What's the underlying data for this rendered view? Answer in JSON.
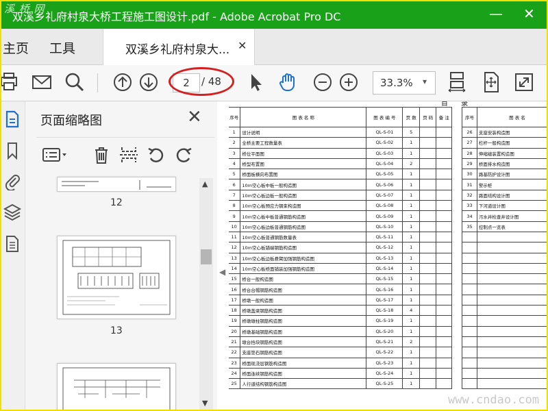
{
  "window": {
    "title": "双溪乡礼府村泉大桥工程施工图设计.pdf - Adobe Acrobat Pro DC",
    "watermark_top": "溪 桥 网",
    "minimize_glyph": "—",
    "close_glyph": "✕"
  },
  "tabs": {
    "home": "主页",
    "tools": "工具",
    "document": "双溪乡礼府村泉大...",
    "document_close": "✕"
  },
  "toolbar": {
    "page_current": "2",
    "page_total": "/ 48",
    "zoom": "33.3%",
    "zoom_arrow": "▾",
    "annotation_color": "#d32020"
  },
  "panel": {
    "title": "页面缩略图",
    "close": "✕",
    "thumbnails": [
      {
        "page": "12"
      },
      {
        "page": "13"
      }
    ],
    "scroll_up": "▲",
    "scroll_down": "▼"
  },
  "document": {
    "heading": "目 录",
    "left_table": {
      "headers": [
        "序号",
        "图 表 名 称",
        "图 表 编 号",
        "页 数",
        "页 码",
        "备 注"
      ],
      "rows": [
        [
          "1",
          "设计说明",
          "QL-S-01",
          "5"
        ],
        [
          "2",
          "全桥主要工程数量表",
          "QL-S-02",
          "1"
        ],
        [
          "3",
          "桥位平面图",
          "QL-S-03",
          "1"
        ],
        [
          "4",
          "桥型布置图",
          "QL-S-04",
          "2"
        ],
        [
          "5",
          "桥面板横向布置图",
          "QL-S-05",
          "1"
        ],
        [
          "6",
          "10m空心板中板一般构造图",
          "QL-S-06",
          "1"
        ],
        [
          "7",
          "10m空心板边板一般构造图",
          "QL-S-07",
          "1"
        ],
        [
          "8",
          "10m空心板预应力钢束构造图",
          "QL-S-08",
          "1"
        ],
        [
          "9",
          "10m空心板中板普通钢筋构造图",
          "QL-S-09",
          "1"
        ],
        [
          "10",
          "10m空心板边板普通钢筋构造图",
          "QL-S-10",
          "1"
        ],
        [
          "11",
          "10m空心板普通钢筋数量表",
          "QL-S-11",
          "1"
        ],
        [
          "12",
          "10m空心板锚端钢筋构造图",
          "QL-S-12",
          "1"
        ],
        [
          "13",
          "10m空心板边板悬臂加强钢筋构造图",
          "QL-S-13",
          "1"
        ],
        [
          "14",
          "10m空心板桥面铺装加强钢筋构造图",
          "QL-S-14",
          "1"
        ],
        [
          "15",
          "桥台一般构造图",
          "QL-S-15",
          "1"
        ],
        [
          "16",
          "桥台台帽钢筋构造图",
          "QL-S-16",
          "1"
        ],
        [
          "17",
          "桥墩一般构造图",
          "QL-S-17",
          "1"
        ],
        [
          "18",
          "桥墩盖梁钢筋构造图",
          "QL-S-18",
          "4"
        ],
        [
          "19",
          "桥墩墩柱钢筋构造图",
          "QL-S-19",
          "1"
        ],
        [
          "20",
          "桥墩基础钢筋构造图",
          "QL-S-20",
          "1"
        ],
        [
          "21",
          "墩台挡块钢筋构造图",
          "QL-S-21",
          "2"
        ],
        [
          "22",
          "支座垫石钢筋构造图",
          "QL-S-22",
          "1"
        ],
        [
          "23",
          "桥面现浇层钢筋构造图",
          "QL-S-23",
          "1"
        ],
        [
          "24",
          "桥面连续钢筋构造图",
          "QL-S-24",
          "1"
        ],
        [
          "25",
          "人行道结构钢筋构造图",
          "QL-S-25",
          "1"
        ]
      ]
    },
    "right_table": {
      "headers": [
        "序号",
        "图 表 名"
      ],
      "rows": [
        [
          "26",
          "支座安装构造图"
        ],
        [
          "27",
          "栏杆一般构造图"
        ],
        [
          "28",
          "伸缩缝装置构造图"
        ],
        [
          "29",
          "桥面排水构造图"
        ],
        [
          "30",
          "路基防护设计图"
        ],
        [
          "31",
          "警示桩"
        ],
        [
          "32",
          "路面结构设计图"
        ],
        [
          "33",
          "下河道设计图"
        ],
        [
          "34",
          "污水井检查井设计图"
        ],
        [
          "35",
          "控制点一览表"
        ]
      ],
      "empty_rows": 15
    }
  },
  "watermark_bottom": "www.cndao.com"
}
